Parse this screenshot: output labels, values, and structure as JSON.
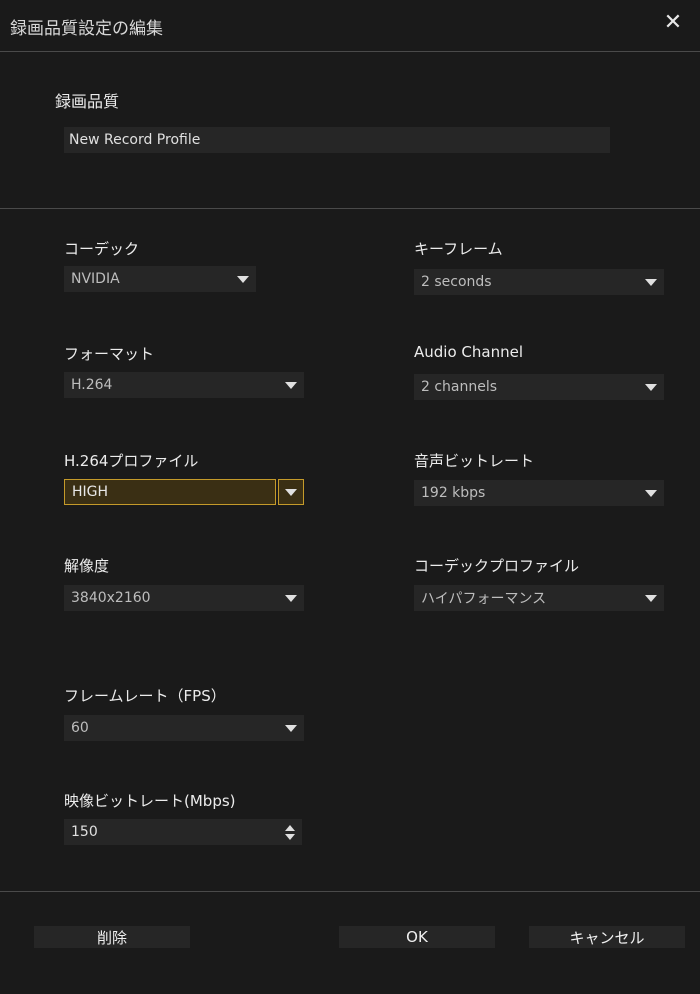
{
  "window": {
    "title": "録画品質設定の編集",
    "close_icon": "close-icon"
  },
  "profile": {
    "label": "録画品質",
    "value": "New Record Profile"
  },
  "fields": {
    "codec": {
      "label": "コーデック",
      "value": "NVIDIA"
    },
    "keyframe": {
      "label": "キーフレーム",
      "value": "2 seconds"
    },
    "format": {
      "label": "フォーマット",
      "value": "H.264"
    },
    "audio_channel": {
      "label": "Audio Channel",
      "value": "2 channels"
    },
    "h264_profile": {
      "label": "H.264プロファイル",
      "value": "HIGH"
    },
    "audio_bitrate": {
      "label": "音声ビットレート",
      "value": "192 kbps"
    },
    "resolution": {
      "label": "解像度",
      "value": "3840x2160"
    },
    "codec_profile": {
      "label": "コーデックプロファイル",
      "value": "ハイパフォーマンス"
    },
    "framerate": {
      "label": "フレームレート（FPS）",
      "value": "60"
    },
    "video_bitrate": {
      "label": "映像ビットレート(Mbps)",
      "value": "150"
    }
  },
  "buttons": {
    "delete": "削除",
    "ok": "OK",
    "cancel": "キャンセル"
  },
  "colors": {
    "background": "#1a1a1a",
    "field_bg": "#262626",
    "accent": "#c49a2a"
  }
}
